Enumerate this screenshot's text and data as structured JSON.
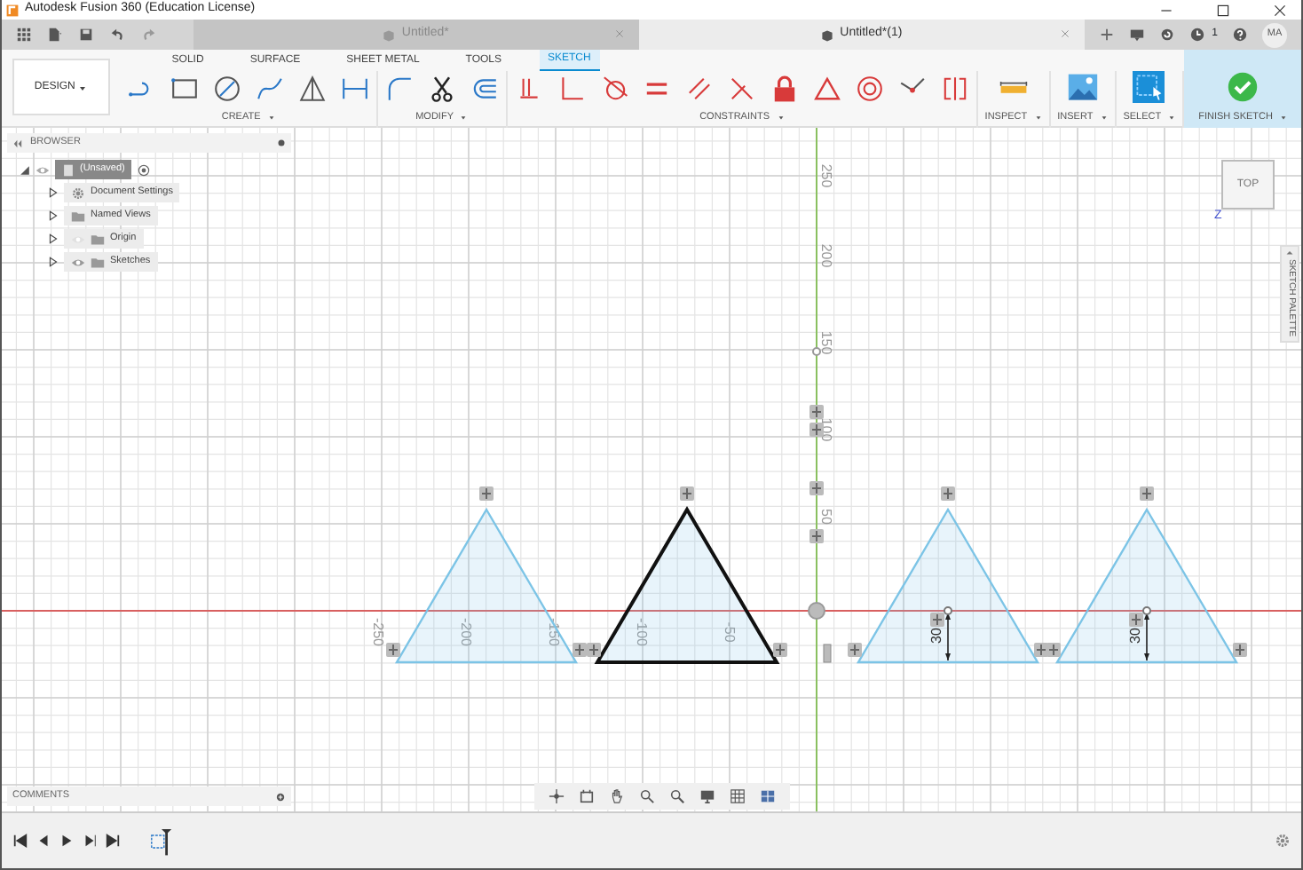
{
  "window": {
    "title": "Autodesk Fusion 360 (Education License)"
  },
  "document_tabs": [
    {
      "label": "Untitled*",
      "selected": false
    },
    {
      "label": "Untitled*(1)",
      "selected": true
    }
  ],
  "job_status": {
    "count": "1"
  },
  "account": {
    "initials": "MA"
  },
  "workspace": {
    "label": "DESIGN"
  },
  "toolbar_tabs": [
    {
      "label": "SOLID",
      "selected": false
    },
    {
      "label": "SURFACE",
      "selected": false
    },
    {
      "label": "SHEET METAL",
      "selected": false
    },
    {
      "label": "TOOLS",
      "selected": false
    },
    {
      "label": "SKETCH",
      "selected": true
    }
  ],
  "tool_groups": [
    {
      "label": "CREATE",
      "kind": "create"
    },
    {
      "label": "MODIFY",
      "kind": "modify"
    },
    {
      "label": "CONSTRAINTS",
      "kind": "constraints"
    },
    {
      "label": "INSPECT",
      "kind": "inspect"
    },
    {
      "label": "INSERT",
      "kind": "insert"
    },
    {
      "label": "SELECT",
      "kind": "select"
    },
    {
      "label": "FINISH SKETCH",
      "kind": "finish"
    }
  ],
  "browser": {
    "title": "BROWSER",
    "root": {
      "label": "(Unsaved)",
      "children": [
        {
          "label": "Document Settings",
          "kind": "settings"
        },
        {
          "label": "Named Views",
          "kind": "folder"
        },
        {
          "label": "Origin",
          "kind": "folder",
          "visible": false
        },
        {
          "label": "Sketches",
          "kind": "folder",
          "visible": true
        }
      ]
    }
  },
  "view_cube": {
    "label": "TOP",
    "axis": "Z"
  },
  "sketch_palette": {
    "label": "SKETCH PALETTE"
  },
  "axes": {
    "y_labels": [
      "250",
      "200",
      "150",
      "100",
      "50"
    ],
    "x_labels": [
      "-250",
      "-200",
      "-150",
      "-100",
      "-50"
    ]
  },
  "profiles": [
    {
      "selected": false
    },
    {
      "selected": true
    },
    {
      "selected": false,
      "dimension": "30"
    },
    {
      "selected": false,
      "dimension": "30"
    }
  ],
  "comments": {
    "title": "COMMENTS"
  }
}
